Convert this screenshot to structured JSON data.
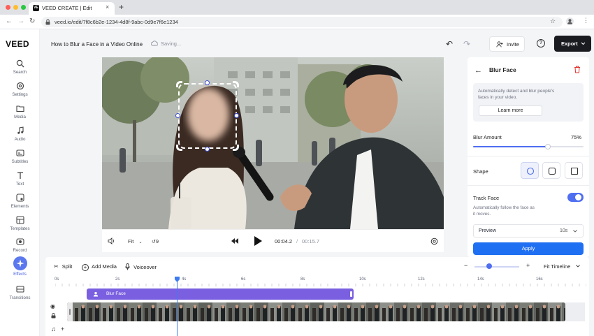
{
  "browser": {
    "tab_title": "VEED CREATE | Edit",
    "tab_favicon": "VE",
    "url": "veed.io/edit/7f8c6b2e-1234-4d8f-9abc-0d9e7f6e1234"
  },
  "sidebar": {
    "logo": "VEED",
    "items": [
      {
        "label": "Search",
        "icon": "search-icon"
      },
      {
        "label": "Settings",
        "icon": "gear-icon"
      },
      {
        "label": "Media",
        "icon": "folder-icon"
      },
      {
        "label": "Audio",
        "icon": "music-note-icon"
      },
      {
        "label": "Subtitles",
        "icon": "subtitles-icon"
      },
      {
        "label": "Text",
        "icon": "text-icon"
      },
      {
        "label": "Elements",
        "icon": "shapes-icon"
      },
      {
        "label": "Templates",
        "icon": "templates-icon"
      },
      {
        "label": "Record",
        "icon": "record-icon"
      },
      {
        "label": "Effects",
        "icon": "sparkle-icon",
        "active": true
      },
      {
        "label": "Transitions",
        "icon": "transitions-icon"
      }
    ]
  },
  "header": {
    "project_title": "How to Blur a Face in a Video Online",
    "save_status": "Saving...",
    "invite_label": "Invite",
    "export_label": "Export"
  },
  "player": {
    "fit_label": "Fit",
    "speed_label": "9",
    "current_time": "00:04.2",
    "separator": "/",
    "total_time": "00:15.7"
  },
  "panel": {
    "title": "Blur Face",
    "info_text": "Automatically detect and blur people's faces in your video.",
    "learn_more": "Learn more",
    "blur_amount_label": "Blur Amount",
    "blur_amount_value": "75%",
    "blur_amount_fraction": 0.68,
    "shape_label": "Shape",
    "shapes": [
      "circle",
      "rounded-square",
      "square"
    ],
    "track_face_label": "Track Face",
    "track_face_on": true,
    "track_face_desc": "Automatically follow the face as it moves.",
    "preview_label": "Preview",
    "preview_value": "10s",
    "apply_label": "Apply"
  },
  "timeline": {
    "split_label": "Split",
    "add_media_label": "Add Media",
    "voiceover_label": "Voiceover",
    "fit_timeline_label": "Fit Timeline",
    "zoom_minus": "−",
    "zoom_plus": "+",
    "ticks": [
      "0s",
      "2s",
      "4s",
      "6s",
      "8s",
      "10s",
      "12s",
      "14s",
      "16s"
    ],
    "blur_clip_label": "Blur Face",
    "add_track": "+"
  },
  "colors": {
    "accent": "#4f6ef0",
    "export_bg": "#1a1b20",
    "blur_clip": "#7a5fe0",
    "delete": "#e0342f",
    "apply": "#1f6ff2"
  }
}
